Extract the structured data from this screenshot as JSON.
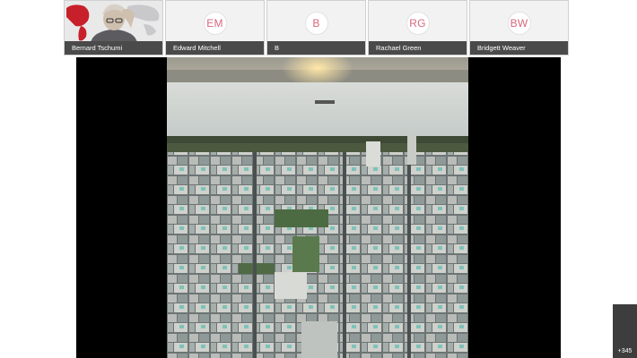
{
  "participants": [
    {
      "name": "Bernard Tschumi",
      "initials": "",
      "has_video": true
    },
    {
      "name": "Edward Mitchell",
      "initials": "EM",
      "has_video": false
    },
    {
      "name": "B",
      "initials": "B",
      "has_video": false
    },
    {
      "name": "Rachael Green",
      "initials": "RG",
      "has_video": false
    },
    {
      "name": "Bridgett Weaver",
      "initials": "BW",
      "has_video": false
    }
  ],
  "colors": {
    "initials": "#d8677c",
    "nameplate": "#4a4a4a",
    "stage_background": "#000000"
  },
  "overflow": {
    "count_label": "+345"
  },
  "shared_content": {
    "icon": "aerial-city-photo"
  }
}
